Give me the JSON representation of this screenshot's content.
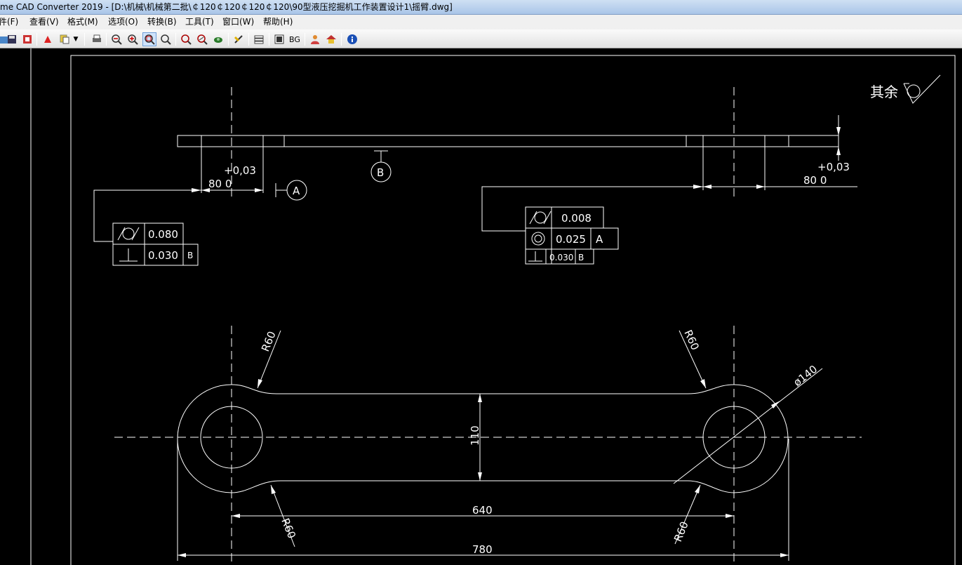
{
  "window": {
    "title": "me CAD Converter 2019 - [D:\\机械\\机械第二批\\￠120￠120￠120￠120\\90型液压挖掘机工作装置设计1\\摇臂.dwg]"
  },
  "menu": [
    {
      "label": "件(F)"
    },
    {
      "label": "查看(V)"
    },
    {
      "label": "格式(M)"
    },
    {
      "label": "选项(O)"
    },
    {
      "label": "转换(B)"
    },
    {
      "label": "工具(T)"
    },
    {
      "label": "窗口(W)"
    },
    {
      "label": "帮助(H)"
    }
  ],
  "toolbar": {
    "bg_label": "BG"
  },
  "drawing": {
    "roughness_note": "其余",
    "tol_left_upper": "+0,03",
    "tol_left_lower": "80 0",
    "tol_right_upper": "+0,03",
    "tol_right_lower": "80 0",
    "datum_a": "A",
    "datum_b": "B",
    "fcf_left_row1": "0.080",
    "fcf_left_row2": "0.030",
    "fcf_left_row2_ref": "B",
    "fcf_right_row1": "0.008",
    "fcf_right_row2": "0.025",
    "fcf_right_row2_ref": "A",
    "fcf_right_row3": "0.030",
    "fcf_right_row3_ref": "B",
    "r60": "R60",
    "dia140": "ø140",
    "dim_110": "110",
    "dim_640": "640",
    "dim_780": "780"
  }
}
